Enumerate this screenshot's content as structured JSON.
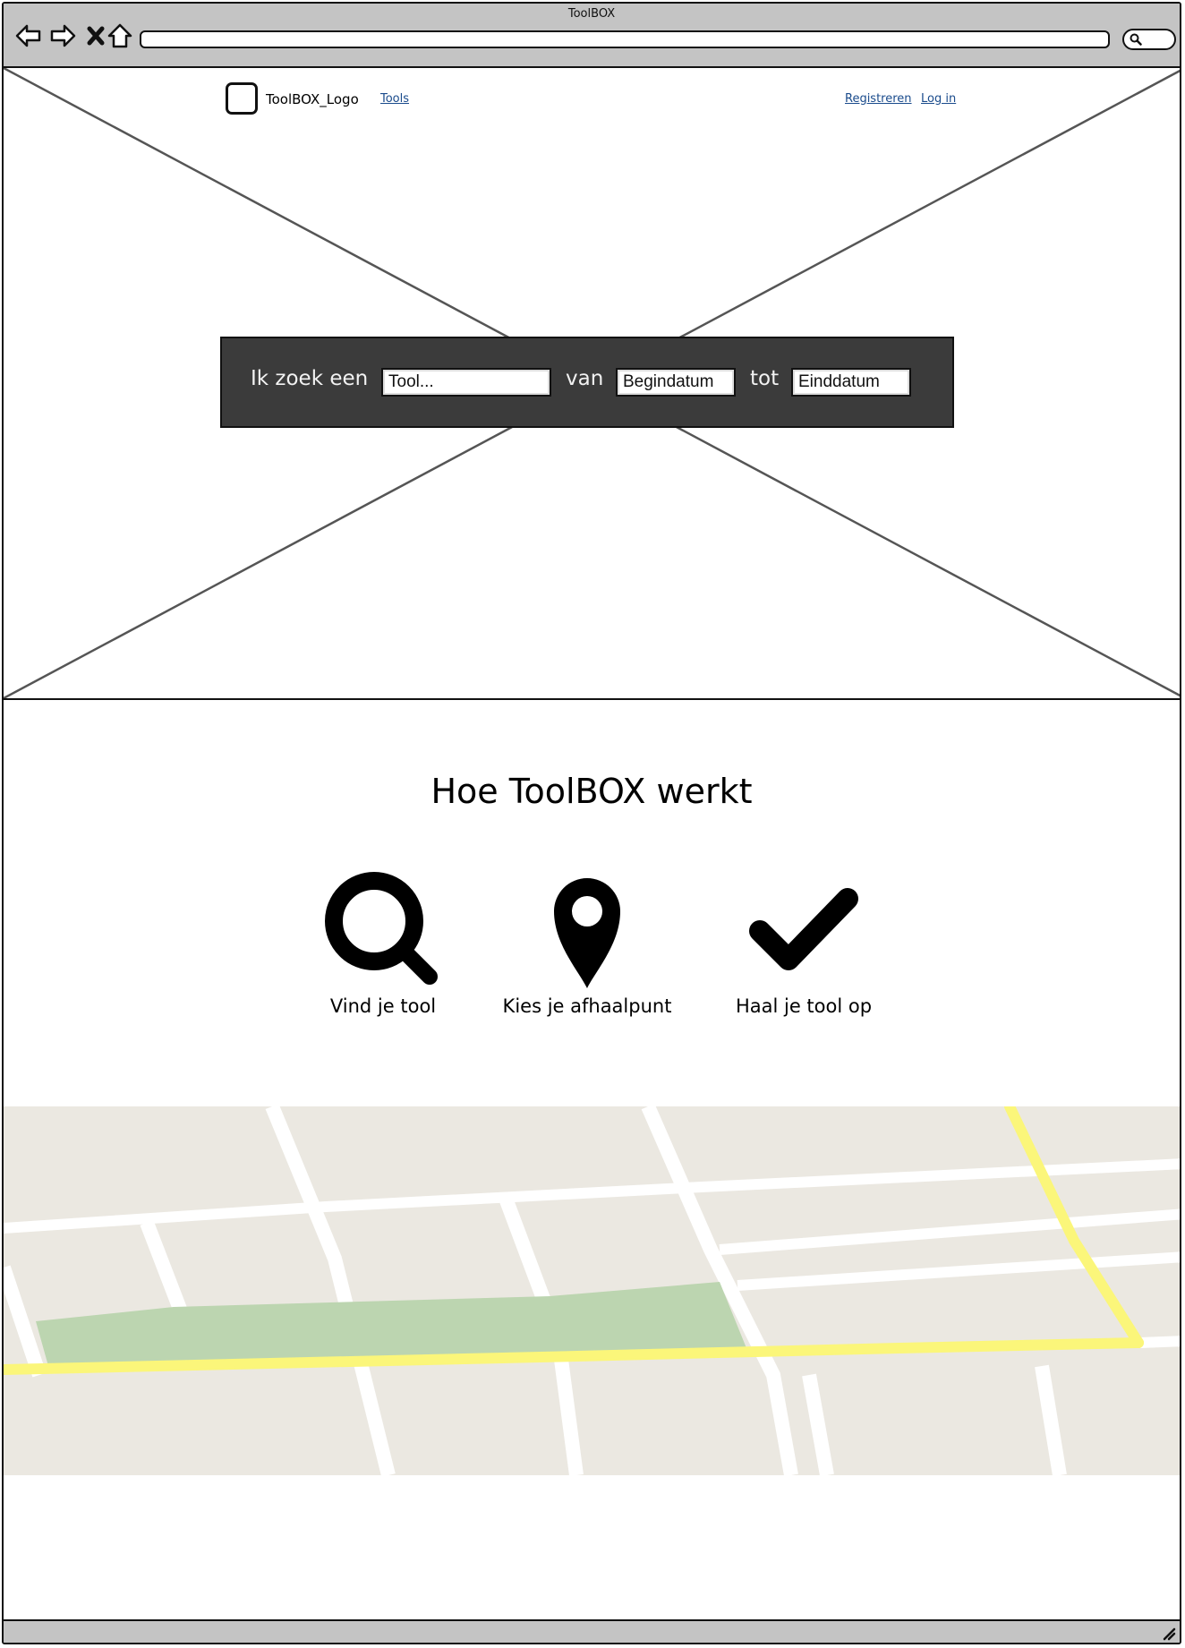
{
  "window": {
    "title": "ToolBOX"
  },
  "header": {
    "logo_text": "ToolBOX_Logo",
    "nav_tools": "Tools",
    "register": "Registreren",
    "login": "Log in"
  },
  "search": {
    "label_prefix": "Ik zoek een",
    "tool_value": "Tool...",
    "label_from": "van",
    "start_value": "Begindatum",
    "label_to": "tot",
    "end_value": "Einddatum"
  },
  "how": {
    "title": "Hoe ToolBOX werkt",
    "steps": [
      {
        "icon": "search-icon",
        "label": "Vind je tool"
      },
      {
        "icon": "map-pin-icon",
        "label": "Kies je afhaalpunt"
      },
      {
        "icon": "checkmark-icon",
        "label": "Haal je tool op"
      }
    ]
  },
  "colors": {
    "chrome": "#c4c4c4",
    "search_panel": "#3b3b3b",
    "map_land": "#ebe8e1",
    "map_park": "#bcd5b0",
    "map_major_road": "#fbf67a",
    "link": "#1a4b8c"
  }
}
